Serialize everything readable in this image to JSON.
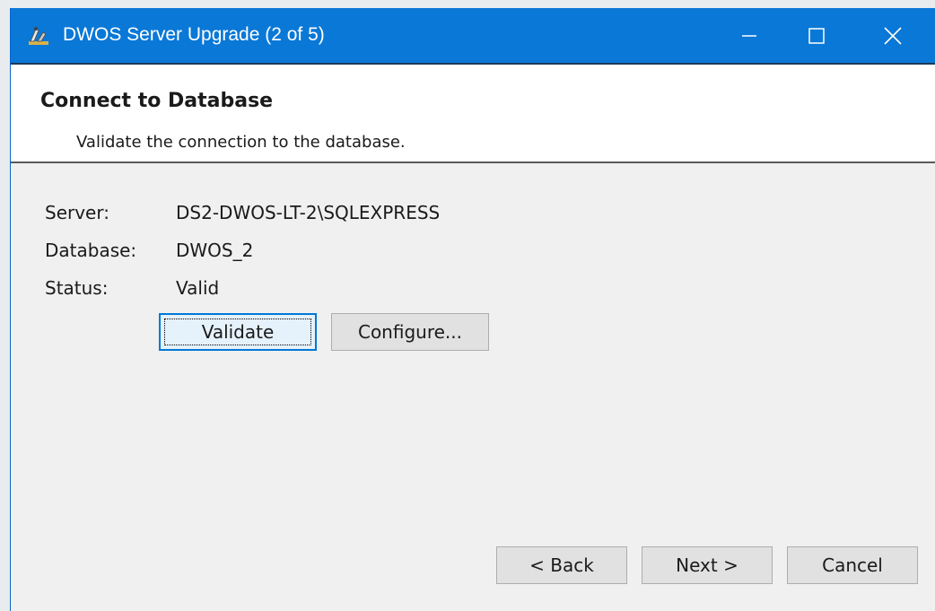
{
  "window": {
    "title": "DWOS Server Upgrade (2 of 5)",
    "controls": {
      "minimize": "minimize-icon",
      "maximize": "maximize-icon",
      "close": "close-icon"
    },
    "accent_color": "#0a78d7"
  },
  "header": {
    "title": "Connect to Database",
    "subtitle": "Validate the connection to the database."
  },
  "fields": {
    "server_label": "Server:",
    "server_value": "DS2-DWOS-LT-2\\SQLEXPRESS",
    "database_label": "Database:",
    "database_value": "DWOS_2",
    "status_label": "Status:",
    "status_value": "Valid"
  },
  "actions": {
    "validate_label": "Validate",
    "configure_label": "Configure..."
  },
  "footer": {
    "back_label": "< Back",
    "next_label": "Next >",
    "cancel_label": "Cancel"
  }
}
